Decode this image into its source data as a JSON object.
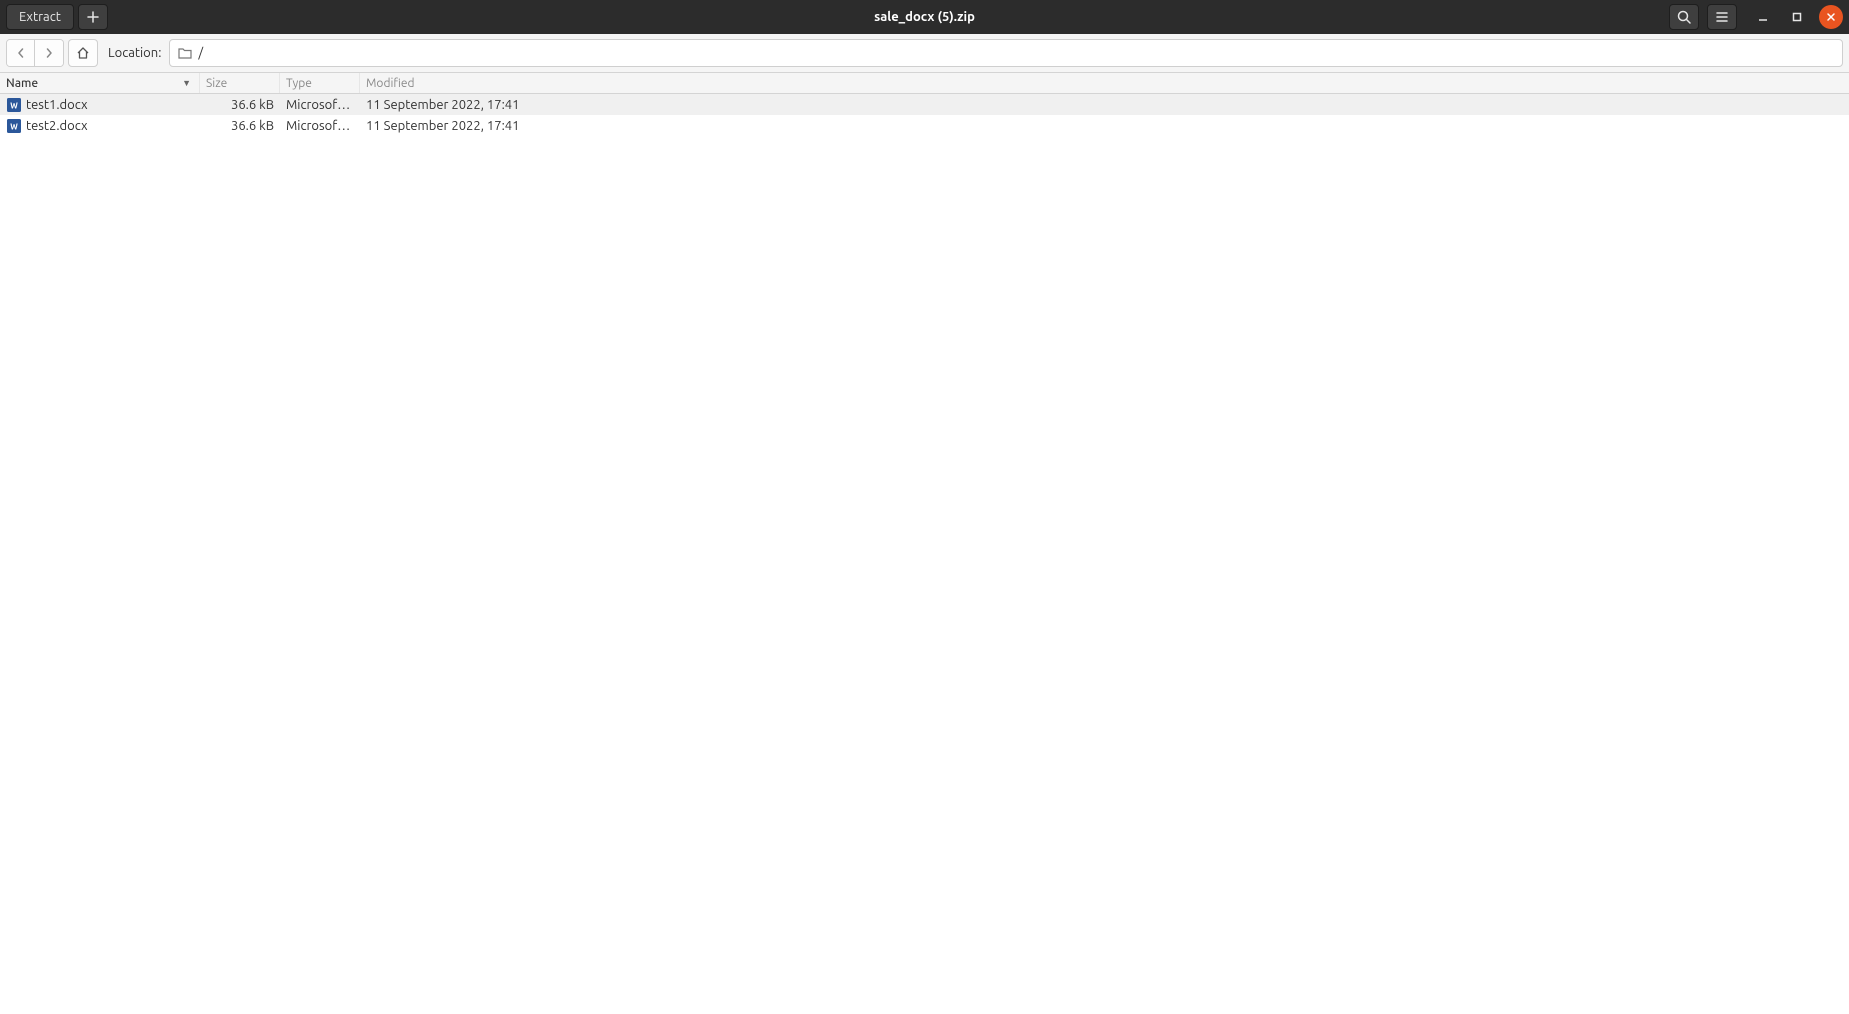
{
  "titlebar": {
    "extract_label": "Extract",
    "title": "sale_docx (5).zip"
  },
  "toolbar": {
    "location_label": "Location:",
    "location_path": "/"
  },
  "columns": {
    "name": "Name",
    "size": "Size",
    "type": "Type",
    "modified": "Modified"
  },
  "files": [
    {
      "name": "test1.docx",
      "size": "36.6 kB",
      "type": "Microsoft …",
      "modified": "11 September 2022, 17:41"
    },
    {
      "name": "test2.docx",
      "size": "36.6 kB",
      "type": "Microsoft …",
      "modified": "11 September 2022, 17:41"
    }
  ]
}
